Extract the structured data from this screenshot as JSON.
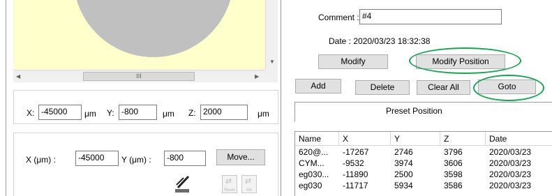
{
  "preview": {
    "scroll_thumb_glyph": "III",
    "arrow_left": "◀",
    "arrow_right": "▶",
    "arrow_down": "▼"
  },
  "position_bar": {
    "x_label": "X:",
    "x_value": "-45000",
    "x_unit": "μm",
    "y_label": "Y:",
    "y_value": "-800",
    "y_unit": "μm",
    "z_label": "Z:",
    "z_value": "2000",
    "z_unit": "μm"
  },
  "move_panel": {
    "x_label": "X (μm) :",
    "x_value": "-45000",
    "y_label": "Y (μm) :",
    "y_value": "-800",
    "move_button": "Move...",
    "reset_label": "Reset",
    "init_label": "Init"
  },
  "details": {
    "comment_label": "Comment :",
    "comment_value": "#4",
    "date_text": "Date : 2020/03/23 18:32:38",
    "modify_button": "Modify",
    "modify_position_button": "Modify Position",
    "add_button": "Add",
    "delete_button": "Delete",
    "clear_all_button": "Clear All",
    "goto_button": "Goto",
    "preset_header": "Preset Position"
  },
  "table": {
    "columns": [
      "Name",
      "X",
      "Y",
      "Z",
      "Date"
    ],
    "rows": [
      [
        "620@...",
        "-17267",
        "2746",
        "3796",
        "2020/03/23"
      ],
      [
        "CYM...",
        "-9532",
        "3974",
        "3606",
        "2020/03/23"
      ],
      [
        "eg030...",
        "-11890",
        "2500",
        "3598",
        "2020/03/23"
      ],
      [
        "eg030",
        "-11717",
        "5934",
        "3586",
        "2020/03/23"
      ]
    ]
  },
  "colors": {
    "highlight": "#10a84f",
    "preview_bg": "#ffffcc",
    "preview_circle": "#c0c0c0"
  }
}
